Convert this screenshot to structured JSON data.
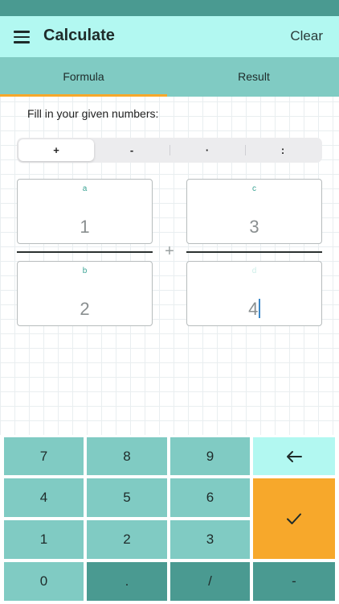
{
  "app_bar": {
    "title": "Calculate",
    "clear_label": "Clear"
  },
  "tabs": [
    {
      "label": "Formula",
      "selected": true
    },
    {
      "label": "Result",
      "selected": false
    }
  ],
  "prompt": "Fill in your given numbers:",
  "operations": [
    {
      "label": "+",
      "selected": true
    },
    {
      "label": "-",
      "selected": false
    },
    {
      "label": "·",
      "selected": false
    },
    {
      "label": ":",
      "selected": false
    }
  ],
  "fractions": {
    "a": {
      "label": "a",
      "value": "1"
    },
    "b": {
      "label": "b",
      "value": "2"
    },
    "c": {
      "label": "c",
      "value": "3"
    },
    "d": {
      "label": "d",
      "value": "4"
    },
    "operator_symbol": "+"
  },
  "keypad": {
    "k7": "7",
    "k8": "8",
    "k9": "9",
    "k4": "4",
    "k5": "5",
    "k6": "6",
    "k1": "1",
    "k2": "2",
    "k3": "3",
    "k0": "0",
    "dot": ".",
    "slash": "/",
    "minus": "-",
    "backspace_icon": "arrow-left-icon",
    "confirm_icon": "checkmark-icon"
  },
  "colors": {
    "status_bar": "#4a9a91",
    "app_bar": "#b2f8f1",
    "tab_bar": "#80cbc3",
    "tab_indicator": "#f7a82b",
    "key": "#80cbc3",
    "key_dark": "#4a9a91",
    "confirm_key": "#f7a82b",
    "label_accent": "#3aa394"
  }
}
